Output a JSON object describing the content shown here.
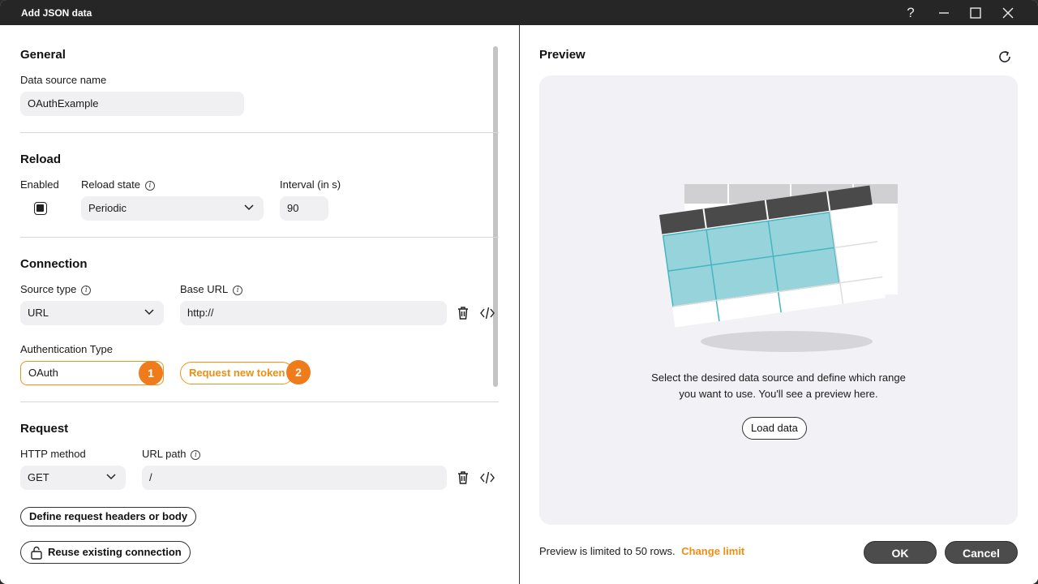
{
  "window": {
    "title": "Add JSON data",
    "controls": [
      "help-icon",
      "minimize-icon",
      "maximize-icon",
      "close-icon"
    ]
  },
  "general": {
    "heading": "General",
    "data_source_label": "Data source name",
    "data_source_value": "OAuthExample"
  },
  "reload": {
    "heading": "Reload",
    "enabled_label": "Enabled",
    "enabled_checked": true,
    "state_label": "Reload state",
    "state_value": "Periodic",
    "interval_label": "Interval (in s)",
    "interval_value": "90"
  },
  "connection": {
    "heading": "Connection",
    "source_type_label": "Source type",
    "source_type_value": "URL",
    "base_url_label": "Base URL",
    "base_url_value": "http://",
    "auth_type_label": "Authentication Type",
    "auth_type_value": "OAuth",
    "request_token_label": "Request new token",
    "badge_1": "1",
    "badge_2": "2"
  },
  "request": {
    "heading": "Request",
    "http_method_label": "HTTP method",
    "http_method_value": "GET",
    "url_path_label": "URL path",
    "url_path_value": "/",
    "define_headers_label": "Define request headers or body"
  },
  "footer_left": {
    "reuse_connection_label": "Reuse existing connection"
  },
  "preview": {
    "heading": "Preview",
    "message_line1": "Select the desired data source and define which range",
    "message_line2": "you want to use. You'll see a preview here.",
    "load_data_label": "Load data",
    "limit_text": "Preview is limited to 50 rows.",
    "change_limit_label": "Change limit"
  },
  "actions": {
    "ok_label": "OK",
    "cancel_label": "Cancel"
  },
  "colors": {
    "accent": "#f07b1a",
    "titlebar": "#262626",
    "highlight_cells": "#96d3da"
  }
}
